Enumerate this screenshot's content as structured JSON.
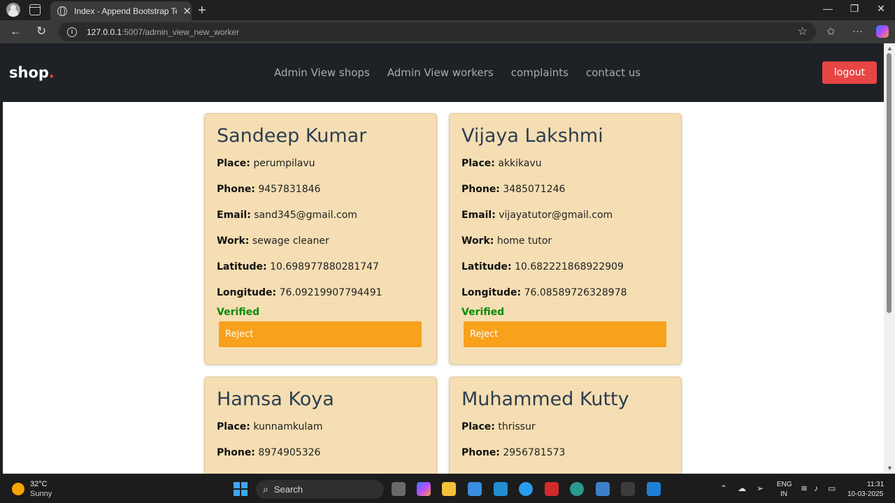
{
  "browser": {
    "tab_title": "Index - Append Bootstrap Templa",
    "url_host": "127.0.0.1",
    "url_path": ":5007/admin_view_new_worker"
  },
  "site": {
    "logo": "shop",
    "logo_dot": ".",
    "nav": [
      "Admin View shops",
      "Admin View workers",
      "complaints",
      "contact us"
    ],
    "logout_label": "logout"
  },
  "labels": {
    "place": "Place:",
    "phone": "Phone:",
    "email": "Email:",
    "work": "Work:",
    "latitude": "Latitude:",
    "longitude": "Longitude:",
    "reject": "Reject"
  },
  "workers": [
    {
      "name": "Sandeep Kumar",
      "place": "perumpilavu",
      "phone": "9457831846",
      "email": "sand345@gmail.com",
      "work": "sewage cleaner",
      "latitude": "10.698977880281747",
      "longitude": "76.09219907794491",
      "status": "Verified"
    },
    {
      "name": "Vijaya Lakshmi",
      "place": "akkikavu",
      "phone": "3485071246",
      "email": "vijayatutor@gmail.com",
      "work": "home tutor",
      "latitude": "10.682221868922909",
      "longitude": "76.08589726328978",
      "status": "Verified"
    },
    {
      "name": "Hamsa Koya",
      "place": "kunnamkulam",
      "phone": "8974905326"
    },
    {
      "name": "Muhammed Kutty",
      "place": "thrissur",
      "phone": "2956781573"
    }
  ],
  "taskbar": {
    "temperature": "32°C",
    "weather": "Sunny",
    "search_label": "Search",
    "lang_top": "ENG",
    "lang_bottom": "IN",
    "time": "11:31",
    "date": "10-03-2025"
  },
  "colors": {
    "header_bg": "#1e2227",
    "accent_red": "#e84545",
    "card_bg": "#f5deb3",
    "reject_orange": "#f7a11d",
    "verified_green": "#0a8a0a"
  }
}
